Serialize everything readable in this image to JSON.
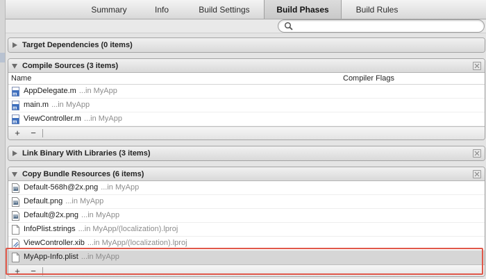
{
  "tabs": [
    {
      "label": "Summary"
    },
    {
      "label": "Info"
    },
    {
      "label": "Build Settings"
    },
    {
      "label": "Build Phases",
      "active": true
    },
    {
      "label": "Build Rules"
    }
  ],
  "search": {
    "value": "",
    "placeholder": ""
  },
  "phases": {
    "target_dependencies": {
      "title": "Target Dependencies (0 items)"
    },
    "compile_sources": {
      "title": "Compile Sources (3 items)",
      "columns": {
        "name": "Name",
        "flags": "Compiler Flags"
      },
      "files": [
        {
          "name": "AppDelegate.m",
          "location": "...in MyApp",
          "icon": "m-source-file-icon"
        },
        {
          "name": "main.m",
          "location": "...in MyApp",
          "icon": "m-source-file-icon"
        },
        {
          "name": "ViewController.m",
          "location": "...in MyApp",
          "icon": "m-source-file-icon"
        }
      ]
    },
    "link_binary": {
      "title": "Link Binary With Libraries (3 items)"
    },
    "copy_bundle": {
      "title": "Copy Bundle Resources (6 items)",
      "files": [
        {
          "name": "Default-568h@2x.png",
          "location": "...in MyApp",
          "icon": "image-file-icon"
        },
        {
          "name": "Default.png",
          "location": "...in MyApp",
          "icon": "image-file-icon"
        },
        {
          "name": "Default@2x.png",
          "location": "...in MyApp",
          "icon": "image-file-icon"
        },
        {
          "name": "InfoPlist.strings",
          "location": "...in MyApp/(localization).lproj",
          "icon": "strings-file-icon"
        },
        {
          "name": "ViewController.xib",
          "location": "...in MyApp/(localization).lproj",
          "icon": "xib-file-icon"
        },
        {
          "name": "MyApp-Info.plist",
          "location": "...in MyApp",
          "icon": "plist-file-icon",
          "selected": true
        }
      ]
    }
  },
  "footer": {
    "add": "+",
    "remove": "−"
  },
  "colors": {
    "highlight": "#e0584a",
    "selected_row": "#d6d6d6",
    "location_text": "#8c8c8c"
  }
}
